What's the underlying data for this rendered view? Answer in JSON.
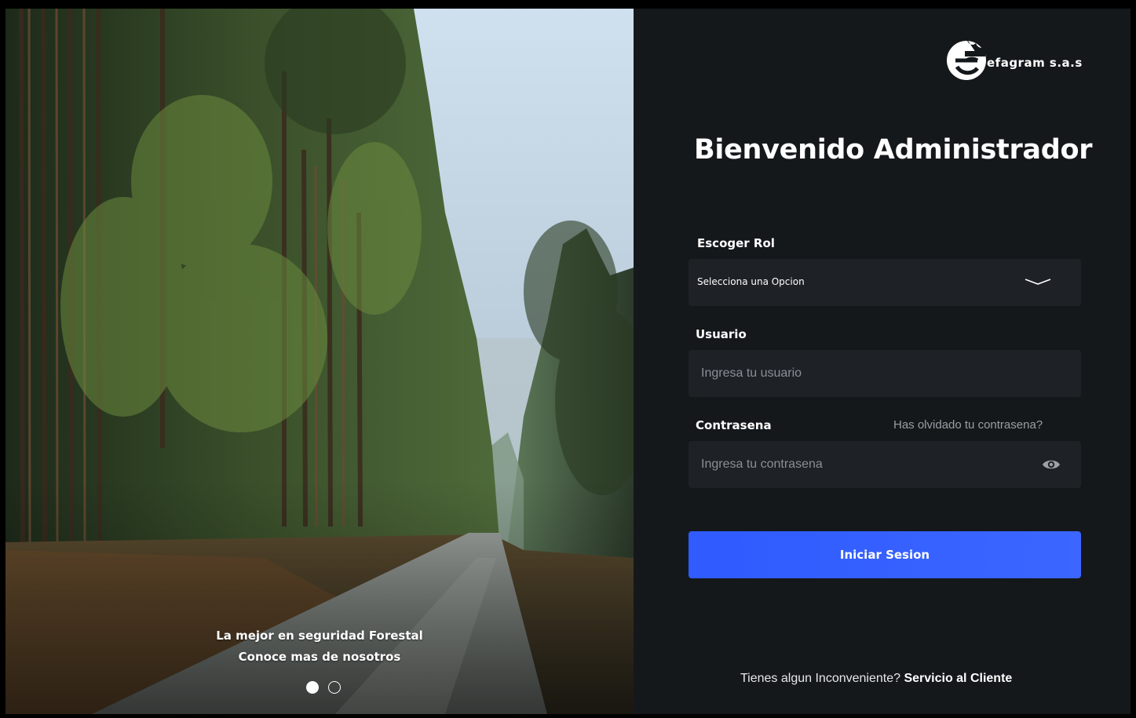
{
  "hero": {
    "caption_line1": "La mejor en seguridad Forestal",
    "caption_line2": "Conoce mas de nosotros",
    "slides": [
      {
        "active": true
      },
      {
        "active": false
      }
    ]
  },
  "brand": {
    "logo_text": "efagram s.a.s",
    "logo_icon": "efagram-logo-icon"
  },
  "login": {
    "title": "Bienvenido Administrador",
    "role_label": "Escoger Rol",
    "role_value": "Selecciona una Opcion",
    "user_label": "Usuario",
    "user_placeholder": "Ingresa tu usuario",
    "password_label": "Contrasena",
    "password_placeholder": "Ingresa tu contrasena",
    "forgot_link": "Has olvidado tu contrasena?",
    "submit_label": "Iniciar Sesion",
    "help_text": "Tienes algun Inconveniente?",
    "help_link": "Servicio al Cliente"
  },
  "colors": {
    "panel_bg": "#15181b",
    "field_bg": "#1e2126",
    "accent": "#2f5bff"
  }
}
